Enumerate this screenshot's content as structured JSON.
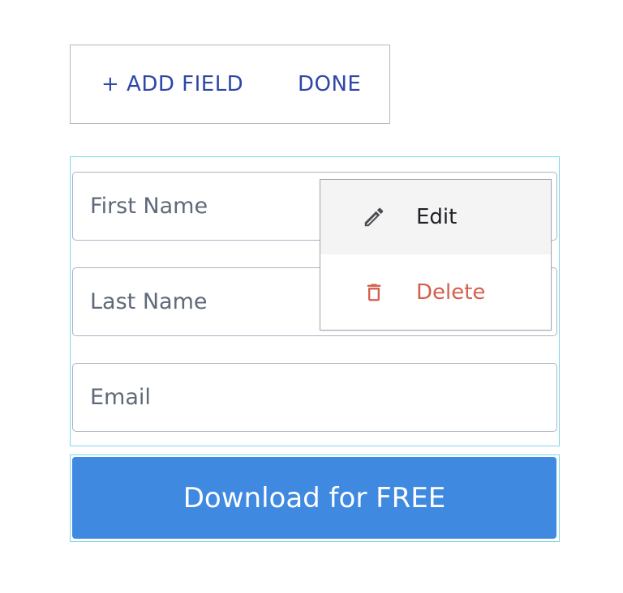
{
  "toolbar": {
    "add_field_label": "+ ADD FIELD",
    "done_label": "DONE"
  },
  "form": {
    "fields": [
      {
        "placeholder": "First Name"
      },
      {
        "placeholder": "Last Name"
      },
      {
        "placeholder": "Email"
      }
    ],
    "submit_label": "Download for FREE"
  },
  "context_menu": {
    "items": [
      {
        "label": "Edit",
        "icon": "pencil-icon"
      },
      {
        "label": "Delete",
        "icon": "trash-icon"
      }
    ]
  },
  "colors": {
    "accent_text": "#2d47a8",
    "selection_outline": "#7dd8ec",
    "submit_button": "#3f8ae0",
    "delete_text": "#d4604e",
    "field_border": "#a8b4c2"
  }
}
